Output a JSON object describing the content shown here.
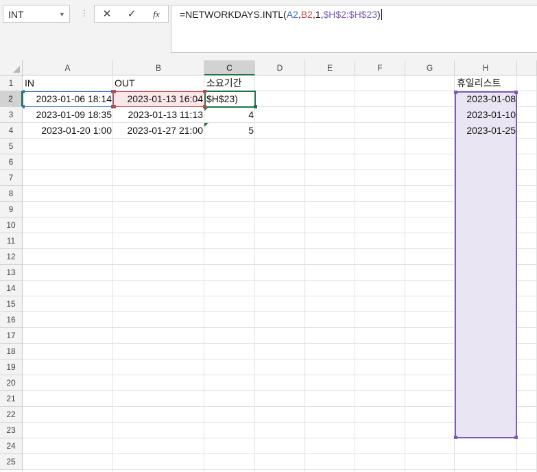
{
  "namebox": {
    "value": "INT",
    "dropdown_icon": "chevron-down-icon"
  },
  "formula_bar": {
    "cancel_icon": "✕",
    "enter_icon": "✓",
    "fx_label": "fx",
    "formula_parts": [
      {
        "text": "=NETWORKDAYS.INTL(",
        "color": "#222222"
      },
      {
        "text": "A2",
        "color": "#3a6fc4"
      },
      {
        "text": ",",
        "color": "#222222"
      },
      {
        "text": "B2",
        "color": "#c0494f"
      },
      {
        "text": ",1,",
        "color": "#222222"
      },
      {
        "text": "$H$2:$H$23",
        "color": "#7d5bb5"
      },
      {
        "text": ")",
        "color": "#222222"
      }
    ]
  },
  "columns": [
    "A",
    "B",
    "C",
    "D",
    "E",
    "F",
    "G",
    "H"
  ],
  "active_column": "C",
  "rows": [
    "1",
    "2",
    "3",
    "4",
    "5",
    "6",
    "7",
    "8",
    "9",
    "10",
    "11",
    "12",
    "13",
    "14",
    "15",
    "16",
    "17",
    "18",
    "19",
    "20",
    "21",
    "22",
    "23",
    "24",
    "25"
  ],
  "active_row": "2",
  "cells": {
    "A1": "IN",
    "B1": "OUT",
    "C1": "소요기간",
    "H1": "휴일리스트",
    "A2": "2023-01-06 18:14",
    "B2": "2023-01-13 16:04",
    "C2": "$H$23)",
    "H2": "2023-01-08",
    "A3": "2023-01-09 18:35",
    "B3": "2023-01-13 11:13",
    "C3": "4",
    "H3": "2023-01-10",
    "A4": "2023-01-20 1:00",
    "B4": "2023-01-27 21:00",
    "C4": "5",
    "H4": "2023-01-25"
  },
  "colors": {
    "accent": "#217346",
    "ref_a2": "#3a6fc4",
    "ref_b2": "#c0494f",
    "ref_h": "#7d5bb5"
  }
}
